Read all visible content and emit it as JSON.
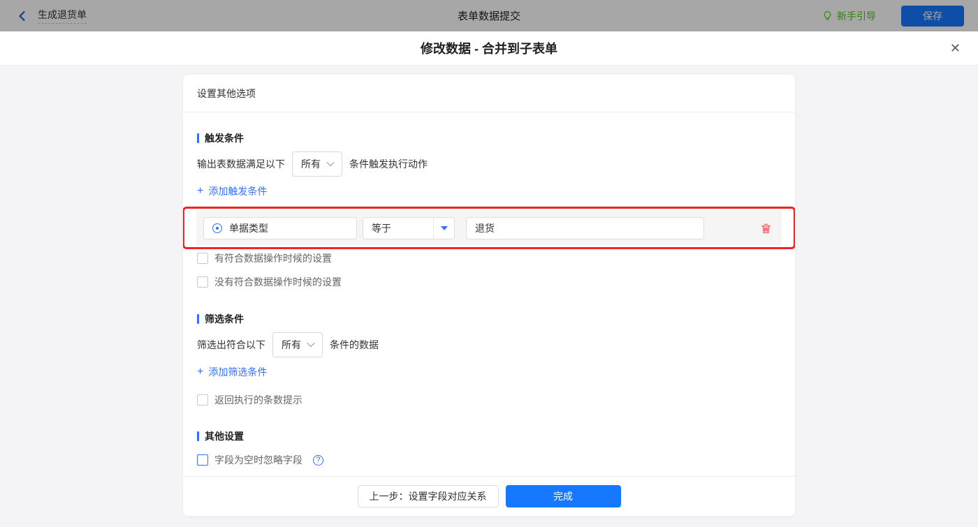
{
  "topbar": {
    "back_label": "生成退货单",
    "center_title": "表单数据提交",
    "guide_label": "新手引导",
    "save_label": "保存"
  },
  "modal": {
    "title": "修改数据 - 合并到子表单",
    "close_glyph": "✕"
  },
  "card": {
    "header": "设置其他选项",
    "trigger": {
      "title": "触发条件",
      "prefix": "输出表数据满足以下",
      "match_select": "所有",
      "suffix": "条件触发执行动作",
      "add_plus": "+",
      "add_label": "添加触发条件",
      "row": {
        "field": "单据类型",
        "operator": "等于",
        "value": "退货"
      },
      "checkbox_has": "有符合数据操作时候的设置",
      "checkbox_none": "没有符合数据操作时候的设置"
    },
    "filter": {
      "title": "筛选条件",
      "prefix": "筛选出符合以下",
      "match_select": "所有",
      "suffix": "条件的数据",
      "add_plus": "+",
      "add_label": "添加筛选条件",
      "checkbox_count": "返回执行的条数提示"
    },
    "other": {
      "title": "其他设置",
      "checkbox_ignore": "字段为空时忽略字段",
      "help_glyph": "?"
    },
    "footer": {
      "prev_label": "上一步：设置字段对应关系",
      "done_label": "完成"
    }
  },
  "colors": {
    "accent_blue": "#1677ff",
    "link_blue": "#3370ff",
    "highlight_red": "#f02222",
    "trash_red": "#f0565f",
    "guide_green": "#52c41a",
    "section_bar_blue": "#3370ff"
  }
}
